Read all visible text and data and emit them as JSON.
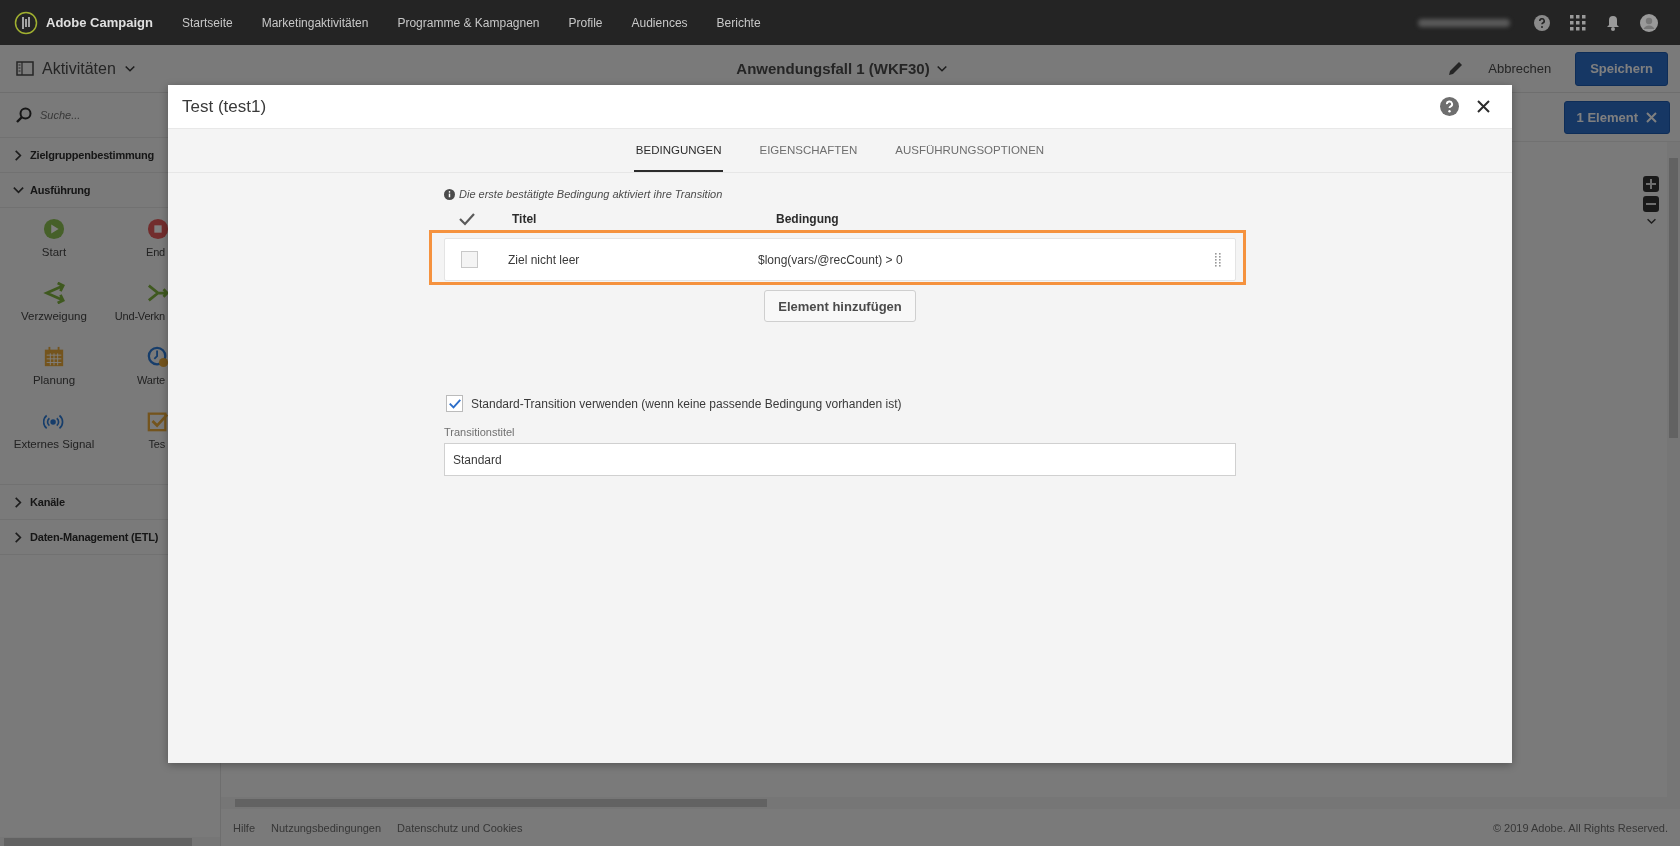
{
  "topnav": {
    "brand": "Adobe Campaign",
    "items": [
      "Startseite",
      "Marketingaktivitäten",
      "Programme & Kampagnen",
      "Profile",
      "Audiences",
      "Berichte"
    ]
  },
  "toolbar": {
    "panel_title": "Aktivitäten",
    "workflow_title": "Anwendungsfall 1 (WKF30)",
    "cancel": "Abbrechen",
    "save": "Speichern"
  },
  "sidebar": {
    "search_placeholder": "Suche...",
    "sections": [
      {
        "label": "Zielgruppenbestimmung",
        "expanded": false
      },
      {
        "label": "Ausführung",
        "expanded": true,
        "activities": [
          {
            "label": "Start",
            "kind": "start"
          },
          {
            "label": "End",
            "kind": "end"
          },
          {
            "label": "Verzweigung",
            "kind": "fork"
          },
          {
            "label": "Und-Verkn",
            "kind": "and"
          },
          {
            "label": "Planung",
            "kind": "scheduler"
          },
          {
            "label": "Warte",
            "kind": "wait"
          },
          {
            "label": "Externes Signal",
            "kind": "signal"
          },
          {
            "label": "Tes",
            "kind": "test"
          }
        ]
      },
      {
        "label": "Kanäle",
        "expanded": false
      },
      {
        "label": "Daten-Management (ETL)",
        "expanded": false
      }
    ]
  },
  "canvas": {
    "selection_button": "1 Element"
  },
  "footer": {
    "links": [
      "Hilfe",
      "Nutzungsbedingungen",
      "Datenschutz und Cookies"
    ],
    "copyright": "© 2019 Adobe. All Rights Reserved."
  },
  "dialog": {
    "title": "Test (test1)",
    "tabs": [
      {
        "label": "BEDINGUNGEN",
        "selected": true
      },
      {
        "label": "EIGENSCHAFTEN",
        "selected": false
      },
      {
        "label": "AUSFÜHRUNGSOPTIONEN",
        "selected": false
      }
    ],
    "info": "Die erste bestätigte Bedingung aktiviert ihre Transition",
    "columns": [
      "Titel",
      "Bedingung"
    ],
    "conditions": [
      {
        "title": "Ziel nicht leer",
        "condition": "$long(vars/@recCount) > 0",
        "checked": false,
        "highlighted": true
      }
    ],
    "add_button": "Element hinzufügen",
    "default_transition": {
      "label": "Standard-Transition verwenden (wenn keine passende Bedingung vorhanden ist)",
      "checked": true
    },
    "transition_title": {
      "label": "Transitionstitel",
      "value": "Standard"
    }
  }
}
